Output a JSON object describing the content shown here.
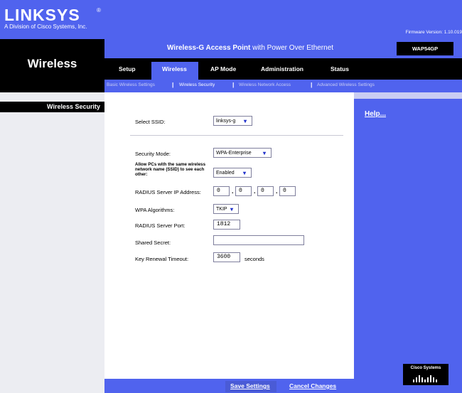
{
  "brand": {
    "logo": "LINKSYS",
    "tm": "®",
    "subtitle": "A Division of Cisco Systems, Inc.",
    "firmware": "Firmware Version: 1.10.019"
  },
  "header": {
    "section_title": "Wireless",
    "product_bold": "Wireless-G Access Point",
    "product_rest": " with Power Over Ethernet",
    "model": "WAP54GP"
  },
  "tabs": [
    {
      "label": "Setup"
    },
    {
      "label": "Wireless",
      "active": true
    },
    {
      "label": "AP Mode"
    },
    {
      "label": "Administration"
    },
    {
      "label": "Status"
    }
  ],
  "subtabs": [
    {
      "label": "Basic Wireless Settings"
    },
    {
      "label": "Wireless Security",
      "active": true
    },
    {
      "label": "Wireless Network Access"
    },
    {
      "label": "Advanced Wireless Settings"
    }
  ],
  "sidebar": {
    "label": "Wireless Security"
  },
  "form": {
    "ssid_label": "Select SSID:",
    "ssid_value": "linksys-g",
    "security_mode_label": "Security Mode:",
    "security_mode_value": "WPA-Enterprise",
    "allow_pcs_label": "Allow PCs with the same wireless network name (SSID) to see each other:",
    "allow_pcs_value": "Enabled",
    "radius_ip_label": "RADIUS Server IP Address:",
    "radius_ip": [
      "0",
      "0",
      "0",
      "0"
    ],
    "wpa_alg_label": "WPA Algorithms:",
    "wpa_alg_value": "TKIP",
    "radius_port_label": "RADIUS Server Port:",
    "radius_port_value": "1812",
    "shared_secret_label": "Shared Secret:",
    "shared_secret_value": "",
    "key_renewal_label": "Key Renewal Timeout:",
    "key_renewal_value": "3600",
    "key_renewal_unit": "seconds"
  },
  "help": {
    "label": "Help..."
  },
  "buttons": {
    "save": "Save Settings",
    "cancel": "Cancel Changes"
  },
  "cisco": {
    "label": "Cisco Systems"
  },
  "colors": {
    "primary_blue": "#5063ee",
    "black": "#000000",
    "sidebar_gray": "#ecedf2"
  }
}
